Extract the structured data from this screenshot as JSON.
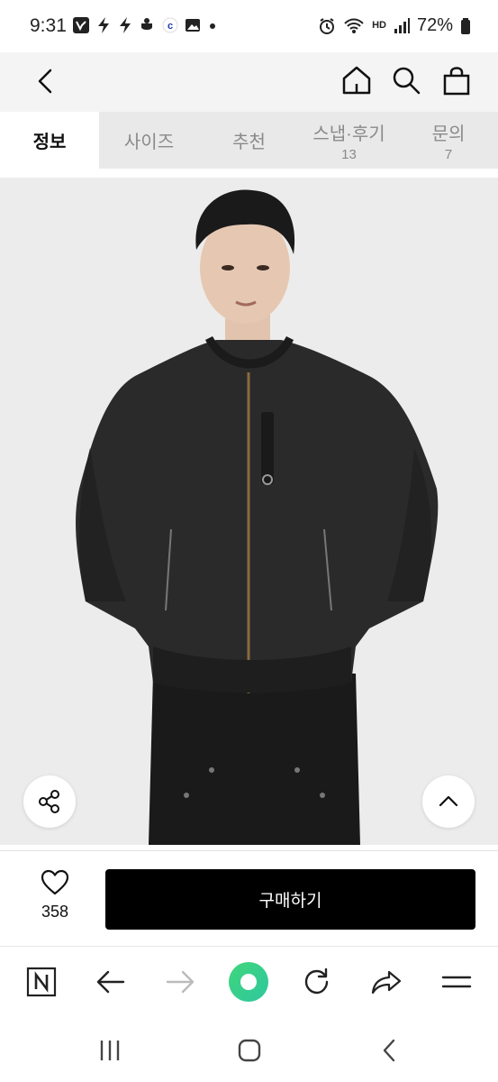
{
  "status_bar": {
    "time": "9:31",
    "battery": "72%",
    "network_label": "HD"
  },
  "top_nav": {
    "back_icon": "chevron-left-icon",
    "home_icon": "home-icon",
    "search_icon": "search-icon",
    "cart_icon": "shopping-bag-icon"
  },
  "tabs": [
    {
      "label": "정보",
      "count": "",
      "active": true
    },
    {
      "label": "사이즈",
      "count": "",
      "active": false
    },
    {
      "label": "추천",
      "count": "",
      "active": false
    },
    {
      "label": "스냅·후기",
      "count": "13",
      "active": false
    },
    {
      "label": "문의",
      "count": "7",
      "active": false
    }
  ],
  "product": {
    "like_count": "358",
    "buy_label": "구매하기"
  },
  "colors": {
    "tab_bg": "#e9e9e9",
    "buy_bg": "#000000",
    "accent_green": "#3fd67a"
  }
}
